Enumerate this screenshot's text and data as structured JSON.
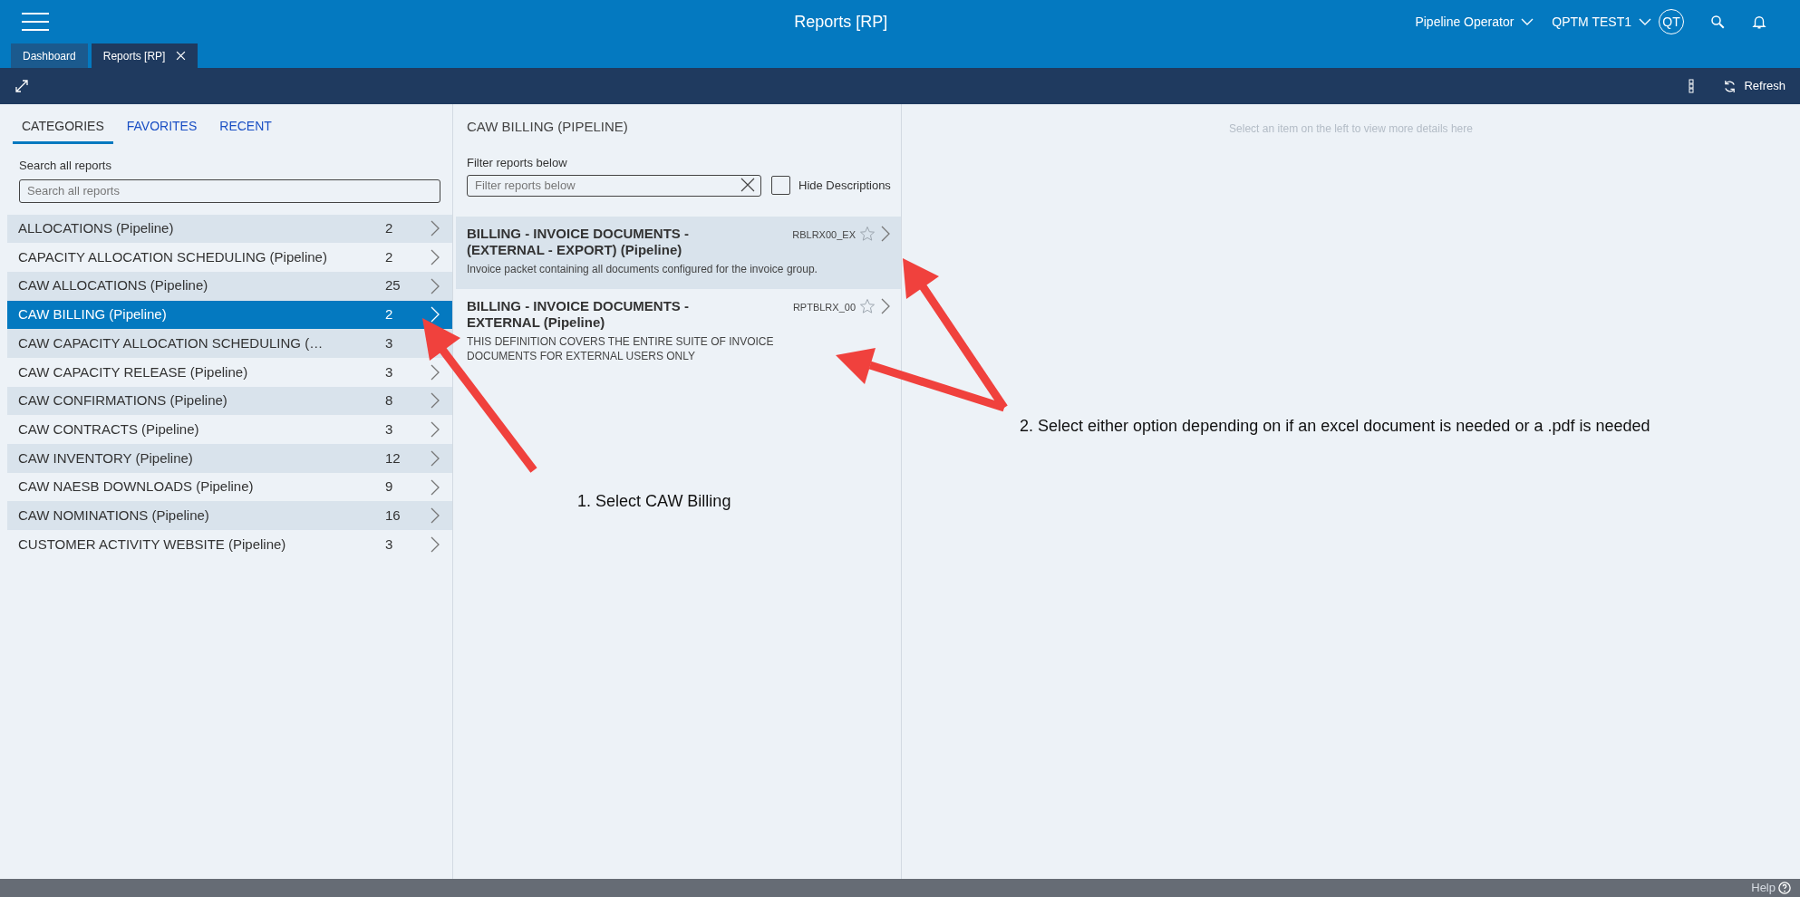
{
  "header": {
    "title": "Reports [RP]",
    "role": "Pipeline Operator",
    "user": "QPTM TEST1",
    "avatar": "QT"
  },
  "tabs": [
    {
      "label": "Dashboard",
      "selected": false
    },
    {
      "label": "Reports [RP]",
      "selected": true
    }
  ],
  "toolbar": {
    "refresh": "Refresh"
  },
  "left": {
    "tabs": [
      {
        "label": "CATEGORIES",
        "selected": true
      },
      {
        "label": "FAVORITES",
        "selected": false
      },
      {
        "label": "RECENT",
        "selected": false
      }
    ],
    "search": {
      "label": "Search all reports",
      "placeholder": "Search all reports"
    },
    "categories": [
      {
        "name": "ALLOCATIONS (Pipeline)",
        "count": "2",
        "selected": false
      },
      {
        "name": "CAPACITY ALLOCATION SCHEDULING (Pipeline)",
        "count": "2",
        "selected": false
      },
      {
        "name": "CAW ALLOCATIONS (Pipeline)",
        "count": "25",
        "selected": false
      },
      {
        "name": "CAW BILLING (Pipeline)",
        "count": "2",
        "selected": true
      },
      {
        "name": "CAW CAPACITY ALLOCATION SCHEDULING (…",
        "count": "3",
        "selected": false
      },
      {
        "name": "CAW CAPACITY RELEASE (Pipeline)",
        "count": "3",
        "selected": false
      },
      {
        "name": "CAW CONFIRMATIONS (Pipeline)",
        "count": "8",
        "selected": false
      },
      {
        "name": "CAW CONTRACTS (Pipeline)",
        "count": "3",
        "selected": false
      },
      {
        "name": "CAW INVENTORY (Pipeline)",
        "count": "12",
        "selected": false
      },
      {
        "name": "CAW NAESB DOWNLOADS (Pipeline)",
        "count": "9",
        "selected": false
      },
      {
        "name": "CAW NOMINATIONS (Pipeline)",
        "count": "16",
        "selected": false
      },
      {
        "name": "CUSTOMER ACTIVITY WEBSITE (Pipeline)",
        "count": "3",
        "selected": false
      }
    ]
  },
  "middle": {
    "title": "CAW BILLING (PIPELINE)",
    "filter": {
      "label": "Filter reports below",
      "placeholder": "Filter reports below"
    },
    "hide_descriptions": {
      "label": "Hide Descriptions",
      "checked": false
    },
    "reports": [
      {
        "title": "BILLING - INVOICE DOCUMENTS - (EXTERNAL - EXPORT) (Pipeline)",
        "code": "RBLRX00_EX",
        "description": "Invoice packet containing all documents configured for the invoice group.",
        "selected": true
      },
      {
        "title": "BILLING - INVOICE DOCUMENTS - EXTERNAL (Pipeline)",
        "code": "RPTBLRX_00",
        "description": "THIS DEFINITION COVERS THE ENTIRE SUITE OF INVOICE DOCUMENTS FOR EXTERNAL USERS ONLY",
        "selected": false
      }
    ]
  },
  "right": {
    "hint": "Select an item on the left to view more details here"
  },
  "footer": {
    "help": "Help"
  },
  "annotations": [
    {
      "text": "1. Select CAW Billing"
    },
    {
      "text": "2. Select either option depending on if an excel document is needed or a .pdf is needed"
    }
  ]
}
